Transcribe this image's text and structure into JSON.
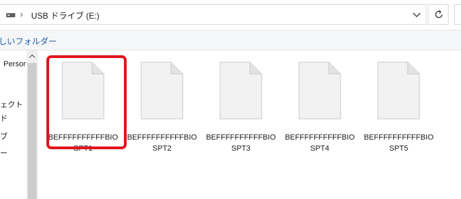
{
  "address": {
    "separator": "›",
    "location": "USB ドライブ (E:)",
    "drive_icon": "drive-icon",
    "dropdown_icon": "chevron-down-icon",
    "refresh_icon": "refresh-icon"
  },
  "toolbar": {
    "new_folder": "しいフォルダー"
  },
  "nav": {
    "items": [
      {
        "label": "Person"
      },
      {
        "label": "ェクト"
      },
      {
        "label": "ド"
      },
      {
        "label": "ブ"
      },
      {
        "label": "ー"
      }
    ]
  },
  "files": [
    {
      "line1": "BEFFFFFFFFFFBIO",
      "line2": "SPT1",
      "selected": true
    },
    {
      "line1": "BEFFFFFFFFFFBIO",
      "line2": "SPT2",
      "selected": false
    },
    {
      "line1": "BEFFFFFFFFFFBIO",
      "line2": "SPT3",
      "selected": false
    },
    {
      "line1": "BEFFFFFFFFFFBIO",
      "line2": "SPT4",
      "selected": false
    },
    {
      "line1": "BEFFFFFFFFFFBIO",
      "line2": "SPT5",
      "selected": false
    }
  ],
  "colors": {
    "highlight": "#e0151c",
    "link": "#1f5fa8"
  }
}
